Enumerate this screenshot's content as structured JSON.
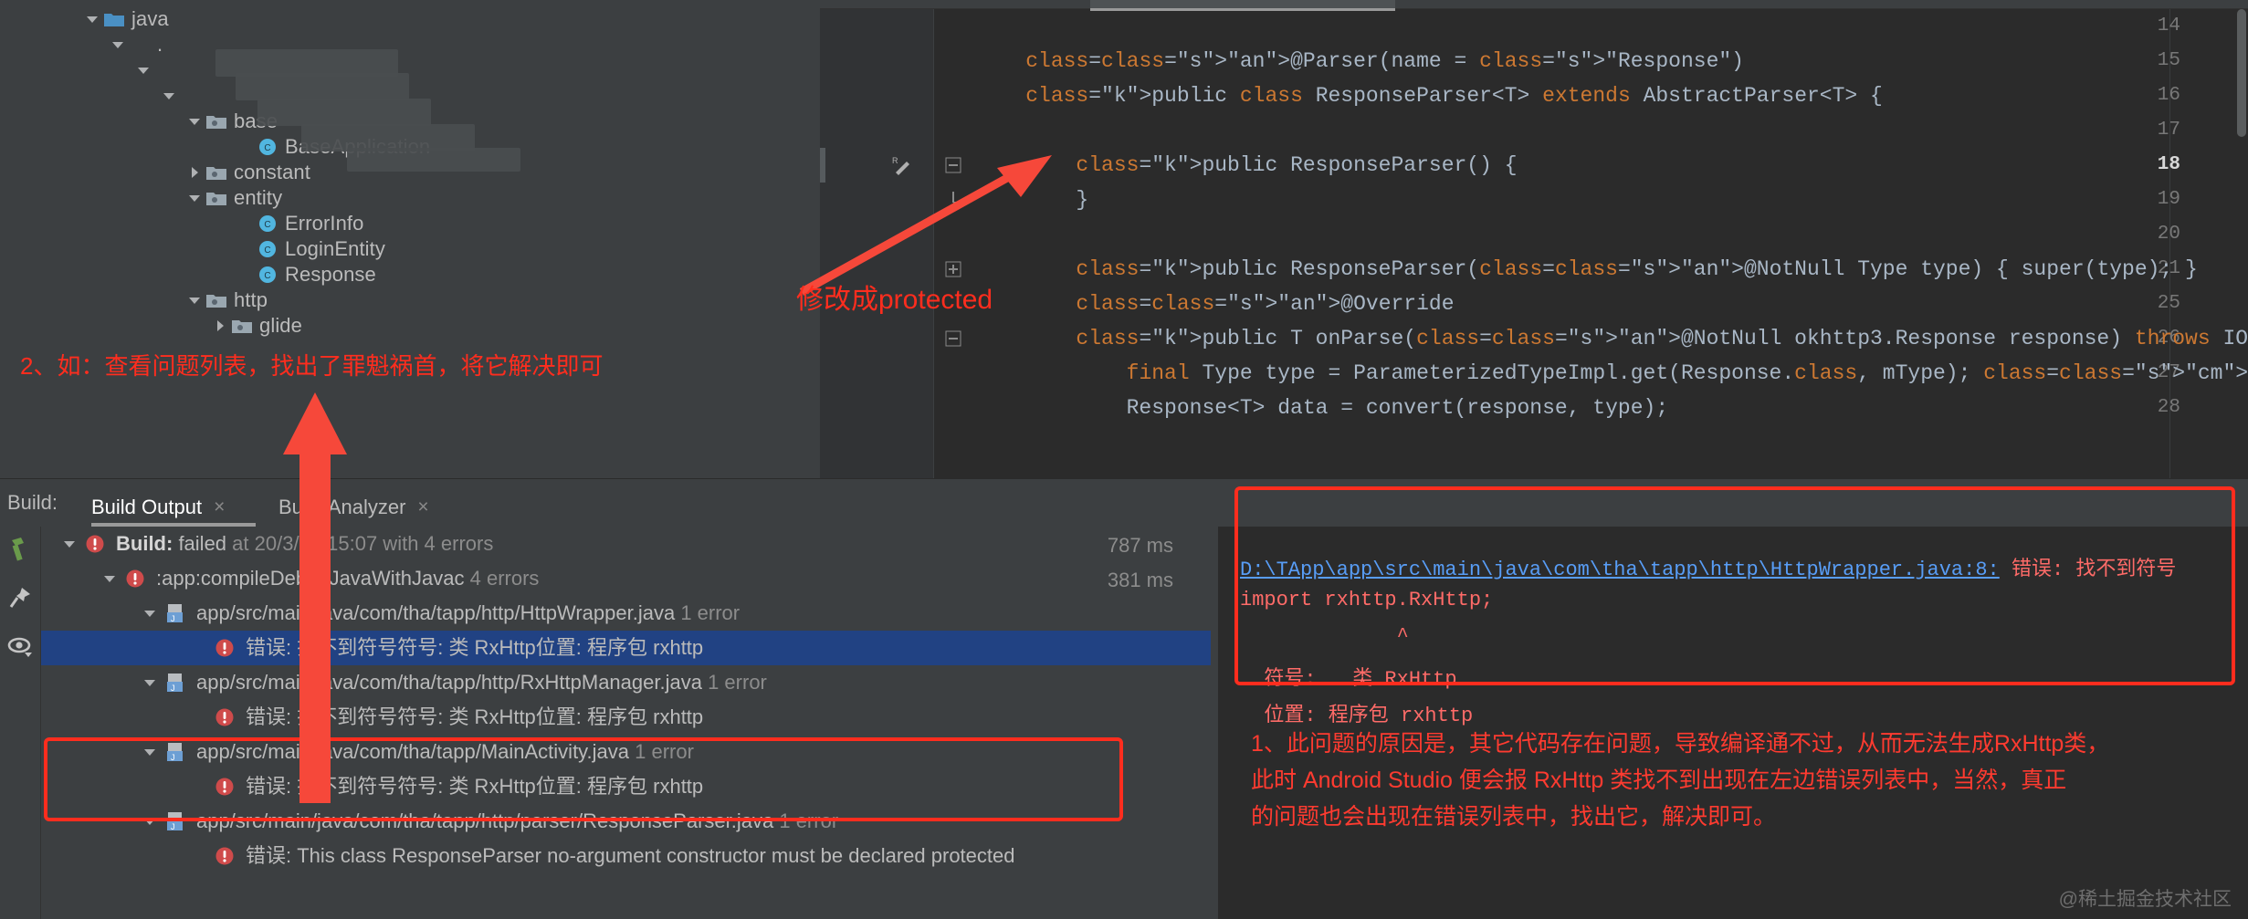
{
  "project_tree": {
    "items": [
      {
        "label": "java",
        "indent": 90,
        "twisty": "down",
        "icon": "folder-blue",
        "redacted": false
      },
      {
        "label": ".",
        "indent": 118,
        "twisty": "down",
        "icon": "none",
        "redacted": true
      },
      {
        "label": "",
        "indent": 146,
        "twisty": "down",
        "icon": "none",
        "redacted": true
      },
      {
        "label": "",
        "indent": 174,
        "twisty": "down",
        "icon": "none",
        "redacted": true
      },
      {
        "label": "base",
        "indent": 202,
        "twisty": "down",
        "icon": "folder-pkg",
        "redacted": false
      },
      {
        "label": "BaseApplication",
        "indent": 258,
        "twisty": "none",
        "icon": "class",
        "redacted": false
      },
      {
        "label": "constant",
        "indent": 202,
        "twisty": "right",
        "icon": "folder-pkg",
        "redacted": false
      },
      {
        "label": "entity",
        "indent": 202,
        "twisty": "down",
        "icon": "folder-pkg",
        "redacted": false
      },
      {
        "label": "ErrorInfo",
        "indent": 258,
        "twisty": "none",
        "icon": "class",
        "redacted": false
      },
      {
        "label": "LoginEntity",
        "indent": 258,
        "twisty": "none",
        "icon": "class",
        "redacted": false
      },
      {
        "label": "Response",
        "indent": 258,
        "twisty": "none",
        "icon": "class",
        "redacted": false
      },
      {
        "label": "http",
        "indent": 202,
        "twisty": "down",
        "icon": "folder-pkg",
        "redacted": false
      },
      {
        "label": "glide",
        "indent": 230,
        "twisty": "right",
        "icon": "folder-pkg",
        "redacted": false
      }
    ]
  },
  "editor": {
    "lines": [
      {
        "num": "14",
        "code": "",
        "current": false,
        "fold": "none",
        "mark": "none"
      },
      {
        "num": "15",
        "code": "    @Parser(name = \"Response\")",
        "current": false,
        "fold": "none",
        "mark": "none"
      },
      {
        "num": "16",
        "code": "    public class ResponseParser<T> extends AbstractParser<T> {",
        "current": false,
        "fold": "none",
        "mark": "none"
      },
      {
        "num": "17",
        "code": "",
        "current": false,
        "fold": "none",
        "mark": "none"
      },
      {
        "num": "18",
        "code": "        public ResponseParser() {",
        "current": true,
        "fold": "minus",
        "mark": "run-edit"
      },
      {
        "num": "19",
        "code": "        }",
        "current": false,
        "fold": "end",
        "mark": "none"
      },
      {
        "num": "20",
        "code": "",
        "current": false,
        "fold": "none",
        "mark": "none"
      },
      {
        "num": "21",
        "code": "        public ResponseParser(@NotNull Type type) { super(type); }",
        "current": false,
        "fold": "plus",
        "mark": "none"
      },
      {
        "num": "25",
        "code": "        @Override",
        "current": false,
        "fold": "none",
        "mark": "none"
      },
      {
        "num": "26",
        "code": "        public T onParse(@NotNull okhttp3.Response response) throws IOException {",
        "current": false,
        "fold": "minus",
        "mark": "none"
      },
      {
        "num": "27",
        "code": "            final Type type = ParameterizedTypeImpl.get(Response.class, mType); //获取泛型类型",
        "current": false,
        "fold": "none",
        "mark": "none"
      },
      {
        "num": "28",
        "code": "            Response<T> data = convert(response, type);",
        "current": false,
        "fold": "none",
        "mark": "none"
      }
    ]
  },
  "build_panel": {
    "title": "Build:",
    "tabs": [
      {
        "label": "Build Output",
        "close": "×",
        "active": true
      },
      {
        "label": "Build Analyzer",
        "close": "×",
        "active": false
      }
    ],
    "sidebar_icons": [
      "hammer-icon",
      "pin-icon",
      "eye-icon"
    ],
    "rows": [
      {
        "indent": 18,
        "twisty": "down",
        "icon": "error",
        "text_html": "<span class=\"b\">Build:</span> failed <span class=\"dim\">at 20</span><span class=\"dim\">/3/23 15:07 with 4 errors</span>",
        "time": "787 ms",
        "selected": false
      },
      {
        "indent": 62,
        "twisty": "down",
        "icon": "error",
        "text_html": ":app:compileDebugJavaWithJavac <span class=\"dim\">4 errors</span>",
        "time": "381 ms",
        "selected": false
      },
      {
        "indent": 106,
        "twisty": "down",
        "icon": "java-file",
        "text_html": "app/src/main/java/com/tha/tapp/http/HttpWrapper.java <span class=\"dim\">1 error</span>",
        "time": "",
        "selected": false
      },
      {
        "indent": 160,
        "twisty": "none",
        "icon": "error",
        "text_html": "错误: 找不到符号符号:  类 RxHttp位置: 程序包 rxhttp",
        "time": "",
        "selected": true
      },
      {
        "indent": 106,
        "twisty": "down",
        "icon": "java-file",
        "text_html": "app/src/main/java/com/tha/tapp/http/RxHttpManager.java <span class=\"dim\">1 error</span>",
        "time": "",
        "selected": false
      },
      {
        "indent": 160,
        "twisty": "none",
        "icon": "error",
        "text_html": "错误: 找不到符号符号:  类 RxHttp位置: 程序包 rxhttp",
        "time": "",
        "selected": false
      },
      {
        "indent": 106,
        "twisty": "down",
        "icon": "java-file",
        "text_html": "app/src/main/java/com/tha/tapp/MainActivity.java <span class=\"dim\">1 error</span>",
        "time": "",
        "selected": false
      },
      {
        "indent": 160,
        "twisty": "none",
        "icon": "error",
        "text_html": "错误: 找不到符号符号:  类 RxHttp位置: 程序包 rxhttp",
        "time": "",
        "selected": false
      },
      {
        "indent": 106,
        "twisty": "down",
        "icon": "java-file",
        "text_html": "app/src/main/java/com/tha/tapp/http/parser/ResponseParser.java <span class=\"dim\">1 error</span>",
        "time": "",
        "selected": false
      },
      {
        "indent": 160,
        "twisty": "none",
        "icon": "error",
        "text_html": "错误: This class ResponseParser no-argument constructor must be declared protected",
        "time": "",
        "selected": false
      }
    ]
  },
  "error_detail": {
    "lines": [
      {
        "link": "D:\\TApp\\app\\src\\main\\java\\com\\tha\\tapp\\http\\HttpWrapper.java:8:",
        "text": " 错误: 找不到符号"
      },
      {
        "link": "",
        "text": "import rxhttp.RxHttp;"
      },
      {
        "link": "",
        "text": "             ^"
      },
      {
        "link": "",
        "text": "  符号:   类 RxHttp"
      },
      {
        "link": "",
        "text": "  位置: 程序包 rxhttp"
      }
    ]
  },
  "annotations": {
    "tree_note": "2、如：查看问题列表，找出了罪魁祸首，将它解决即可",
    "editor_note": "修改成protected",
    "bottom_note_lines": [
      "1、此问题的原因是，其它代码存在问题，导致编译通不过，从而无法生成RxHttp类，",
      "此时 Android Studio 便会报 RxHttp 类找不到出现在左边错误列表中，当然，真正",
      "的问题也会出现在错误列表中，找出它，解决即可。"
    ],
    "accent_color": "#ff2d1e"
  },
  "watermark": "@稀土掘金技术社区"
}
